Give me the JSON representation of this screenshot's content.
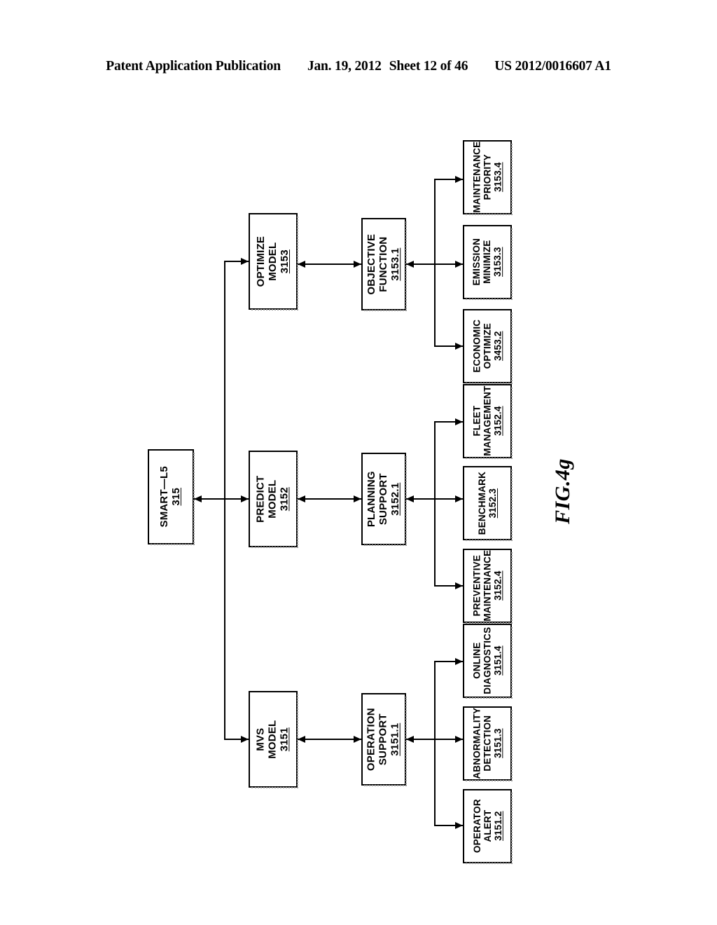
{
  "header": {
    "publication": "Patent Application Publication",
    "date": "Jan. 19, 2012",
    "sheet": "Sheet 12 of 46",
    "docket": "US 2012/0016607 A1"
  },
  "figure": {
    "caption": "FIG.4g",
    "orientation": "landscape-rotated-90ccw",
    "root": {
      "id": "smart-l5",
      "line1": "SMART—L5",
      "line2": "",
      "ref": "315"
    },
    "models": [
      {
        "id": "optimize-model",
        "line1": "OPTIMIZE",
        "line2": "MODEL",
        "ref": "3153"
      },
      {
        "id": "predict-model",
        "line1": "PREDICT",
        "line2": "MODEL",
        "ref": "3152"
      },
      {
        "id": "mvs-model",
        "line1": "MVS",
        "line2": "MODEL",
        "ref": "3151"
      }
    ],
    "supports": [
      {
        "id": "objective-function",
        "line1": "OBJECTIVE",
        "line2": "FUNCTION",
        "ref": "3153.1"
      },
      {
        "id": "planning-support",
        "line1": "PLANNING",
        "line2": "SUPPORT",
        "ref": "3152.1"
      },
      {
        "id": "operation-support",
        "line1": "OPERATION",
        "line2": "SUPPORT",
        "ref": "3151.1"
      }
    ],
    "leaves": {
      "optimize": [
        {
          "id": "maintenance-priority",
          "line1": "MAINTENANCE",
          "line2": "PRIORITY",
          "ref": "3153.4"
        },
        {
          "id": "emission-minimize",
          "line1": "EMISSION",
          "line2": "MINIMIZE",
          "ref": "3153.3"
        },
        {
          "id": "economic-optimize",
          "line1": "ECONOMIC",
          "line2": "OPTIMIZE",
          "ref": "3453.2"
        }
      ],
      "predict": [
        {
          "id": "fleet-management",
          "line1": "FLEET",
          "line2": "MANAGEMENT",
          "ref": "3152.4"
        },
        {
          "id": "benchmark",
          "line1": "BENCHMARK",
          "line2": "",
          "ref": "3152.3"
        },
        {
          "id": "preventive-maintenance",
          "line1": "PREVENTIVE",
          "line2": "MAINTENANCE",
          "ref": "3152.4"
        }
      ],
      "mvs": [
        {
          "id": "online-diagnostics",
          "line1": "ONLINE",
          "line2": "DIAGNOSTICS",
          "ref": "3151.4"
        },
        {
          "id": "abnormality-detection",
          "line1": "ABNORMALITY",
          "line2": "DETECTION",
          "ref": "3151.3"
        },
        {
          "id": "operator-alert",
          "line1": "OPERATOR",
          "line2": "ALERT",
          "ref": "3151.2"
        }
      ]
    }
  }
}
